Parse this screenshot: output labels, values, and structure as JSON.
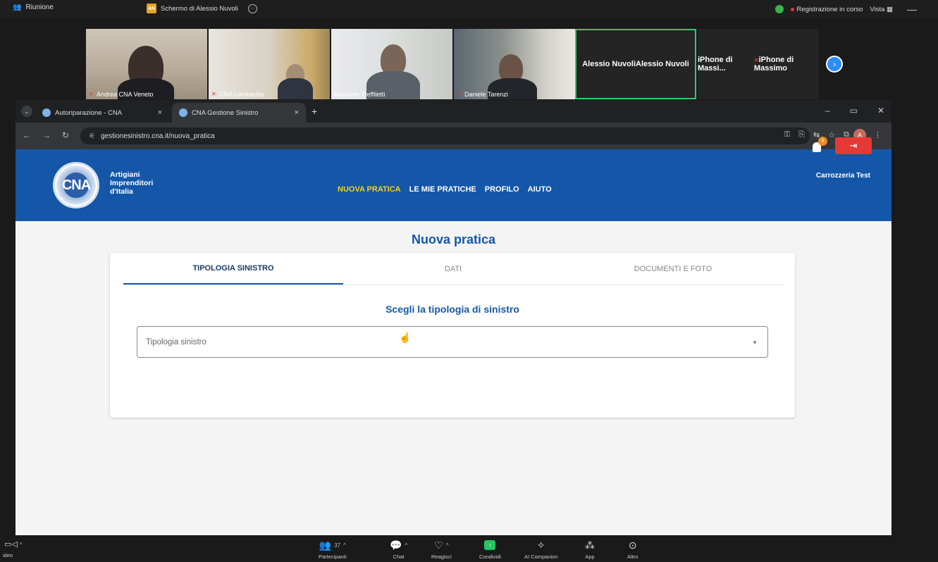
{
  "zoom": {
    "meeting_label": "Riunione",
    "share_label": "Schermo di Alessio Nuvoli",
    "sharer_initials": "AN",
    "recording": "Registrazione in corso",
    "view": "Vista",
    "participants": [
      {
        "name": "Andrea CNA Veneto"
      },
      {
        "name": "CNA Lombardia"
      },
      {
        "name": "Massimo Treffiletti"
      },
      {
        "name": "Daniele Tarenzi"
      },
      {
        "name": "Alessio Nuvoli",
        "display": "Alessio Nuvoli"
      },
      {
        "name": "iPhone di Massimo",
        "display": "iPhone di Massi..."
      }
    ],
    "bottom": {
      "video": "ideo",
      "participants_count": "37",
      "participants": "Partecipanti",
      "chat": "Chat",
      "react": "Reagisci",
      "share": "Condividi",
      "ai": "AI Companion",
      "app": "App",
      "more": "Altro"
    }
  },
  "browser": {
    "tabs": [
      {
        "label": "Autoriparazione - CNA"
      },
      {
        "label": "CNA Gestione Sinistro"
      }
    ],
    "url": "gestionesinistro.cna.it/nuova_pratica",
    "profile_initial": "A"
  },
  "site": {
    "logo_text": "CNA",
    "brand_lines": [
      "Artigiani",
      "Imprenditori",
      "d'Italia"
    ],
    "nav": [
      "NUOVA PRATICA",
      "LE MIE PRATICHE",
      "PROFILO",
      "AIUTO"
    ],
    "user": "Carrozzeria Test",
    "notifications": "8",
    "page_title": "Nuova pratica",
    "steps": [
      "TIPOLOGIA SINISTRO",
      "DATI",
      "DOCUMENTI E FOTO"
    ],
    "section_title": "Scegli la tipologia di sinistro",
    "select_placeholder": "Tipologia sinistro"
  },
  "colors": {
    "header_blue": "#1457a8",
    "nav_active": "#f5d01b",
    "logout_red": "#e53935",
    "tile_active": "#2ecc71"
  }
}
